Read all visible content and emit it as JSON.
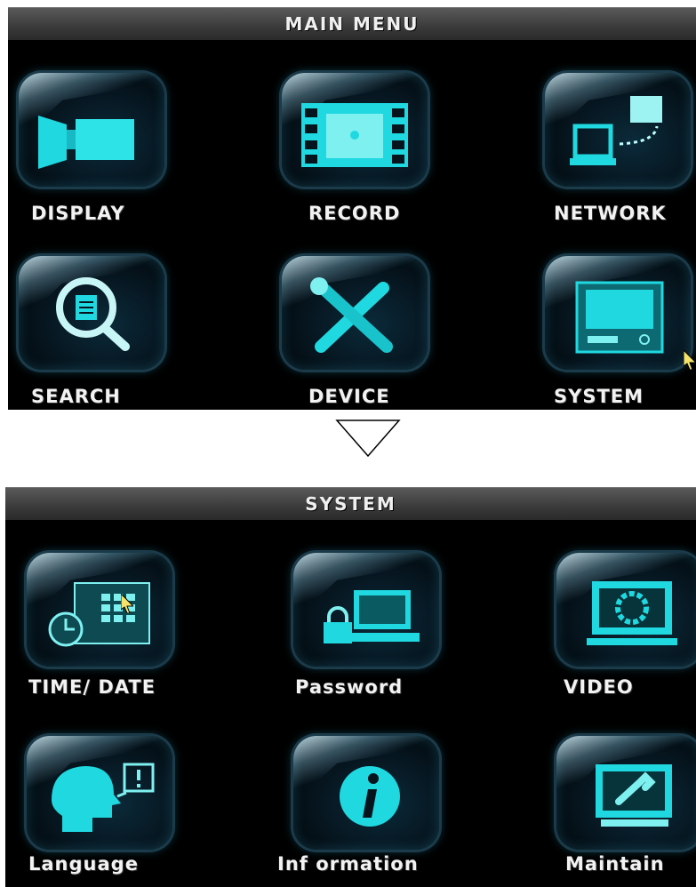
{
  "main_menu": {
    "title": "MAIN  MENU",
    "items": [
      {
        "label": "DISPLAY",
        "icon": "display-icon"
      },
      {
        "label": "RECORD",
        "icon": "film-record-icon"
      },
      {
        "label": "NETWORK",
        "icon": "network-icon"
      },
      {
        "label": "SEARCH",
        "icon": "search-magnifier-icon"
      },
      {
        "label": "DEVICE",
        "icon": "tools-icon"
      },
      {
        "label": "SYSTEM",
        "icon": "computer-system-icon"
      }
    ]
  },
  "system_menu": {
    "title": "SYSTEM",
    "items": [
      {
        "label": "TIME/ DATE",
        "icon": "clock-calendar-icon"
      },
      {
        "label": "Password",
        "icon": "lock-monitor-icon"
      },
      {
        "label": "VIDEO",
        "icon": "video-monitor-icon"
      },
      {
        "label": "Language",
        "icon": "speaking-head-icon"
      },
      {
        "label": "Inf ormation",
        "icon": "info-icon"
      },
      {
        "label": "Maintain",
        "icon": "wrench-monitor-icon"
      }
    ]
  },
  "colors": {
    "icon_cyan": "#1fd8e0",
    "icon_light": "#7ff0f0",
    "title_bg": "#3f3f3f"
  }
}
